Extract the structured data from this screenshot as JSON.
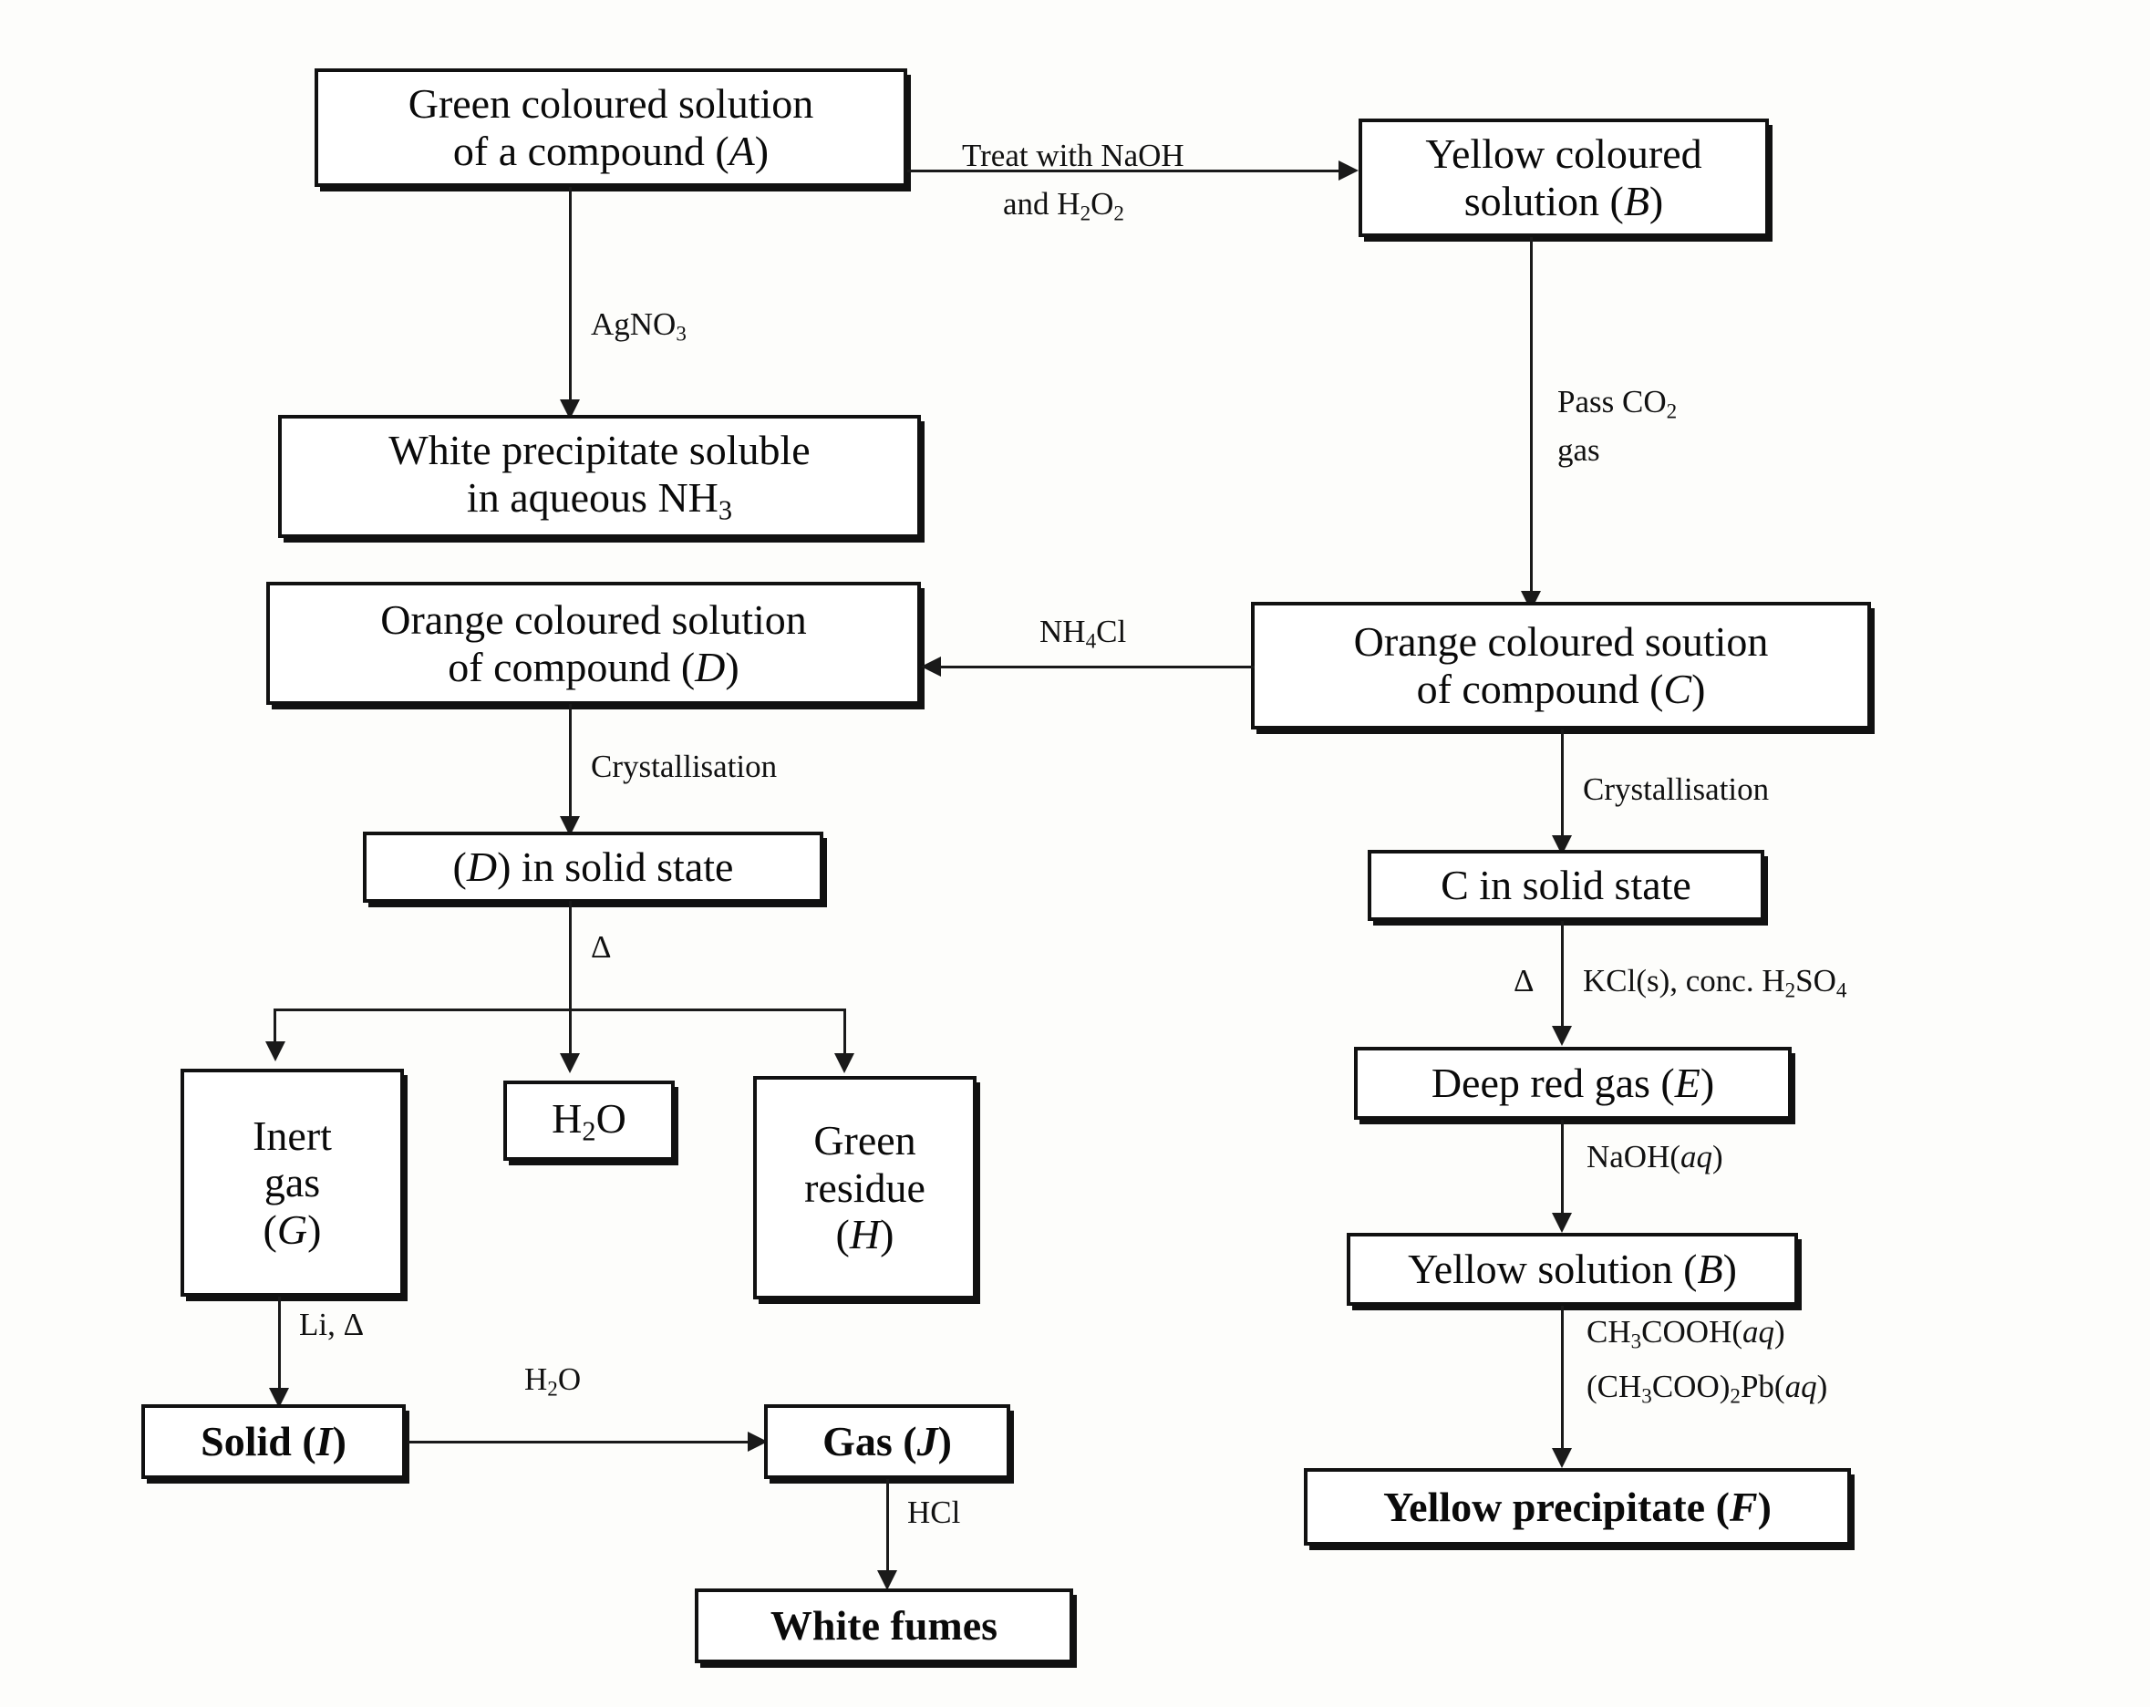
{
  "diagram": {
    "title": "Inorganic qualitative analysis flowchart (compounds A-J)",
    "nodes": {
      "a": "Green coloured solution\nof a compound (A)",
      "b": "Yellow coloured\nsolution (B)",
      "white_ppt": "White precipitate soluble\nin aqueous NH₃",
      "d_solution": "Orange coloured solution\nof compound (D)",
      "c_solution": "Orange coloured soution\nof compound (C)",
      "d_solid": "(D) in solid state",
      "c_solid": "C in solid state",
      "inert_gas": "Inert\ngas\n(G)",
      "water": "H₂O",
      "green_residue": "Green\nresidue\n(H)",
      "solid_i": "Solid (I)",
      "gas_j": "Gas (J)",
      "white_fumes": "White fumes",
      "deep_red_gas": "Deep red gas (E)",
      "yellow_solution_b": "Yellow solution (B)",
      "yellow_ppt": "Yellow precipitate (F)"
    },
    "edge_labels": {
      "a_to_b_line1": "Treat with NaOH",
      "a_to_b_line2": "and H₂O₂",
      "a_to_white_ppt": "AgNO₃",
      "b_to_c": "Pass CO₂",
      "b_to_c_line2": "gas",
      "c_to_d": "NH₄Cl",
      "d_crystallisation": "Crystallisation",
      "c_crystallisation": "Crystallisation",
      "d_heat": "Δ",
      "c_heat": "Δ",
      "c_reagent": "KCl(s), conc. H₂SO₄",
      "g_to_i": "Li, Δ",
      "i_to_j": "H₂O",
      "j_to_fumes": "HCl",
      "e_to_b": "NaOH(aq)",
      "b_to_f_line1": "CH₃COOH(aq)",
      "b_to_f_line2": "(CH₃COO)₂Pb(aq)"
    }
  },
  "chart_data": {
    "type": "diagram",
    "title": "Reaction scheme: identification of compounds A through J",
    "nodes": [
      {
        "id": "A",
        "label": "Green coloured solution of a compound (A)"
      },
      {
        "id": "B",
        "label": "Yellow coloured solution (B)"
      },
      {
        "id": "WP",
        "label": "White precipitate soluble in aqueous NH3"
      },
      {
        "id": "D",
        "label": "Orange coloured solution of compound (D)"
      },
      {
        "id": "C",
        "label": "Orange coloured soution of compound (C)"
      },
      {
        "id": "Dsolid",
        "label": "(D) in solid state"
      },
      {
        "id": "Csolid",
        "label": "C in solid state"
      },
      {
        "id": "G",
        "label": "Inert gas (G)"
      },
      {
        "id": "H2O",
        "label": "H2O"
      },
      {
        "id": "H",
        "label": "Green residue (H)"
      },
      {
        "id": "I",
        "label": "Solid (I)"
      },
      {
        "id": "J",
        "label": "Gas (J)"
      },
      {
        "id": "WF",
        "label": "White fumes"
      },
      {
        "id": "E",
        "label": "Deep red gas (E)"
      },
      {
        "id": "B2",
        "label": "Yellow solution (B)"
      },
      {
        "id": "F",
        "label": "Yellow precipitate (F)"
      }
    ],
    "edges": [
      {
        "from": "A",
        "to": "B",
        "label": "Treat with NaOH and H2O2"
      },
      {
        "from": "A",
        "to": "WP",
        "label": "AgNO3"
      },
      {
        "from": "B",
        "to": "C",
        "label": "Pass CO2 gas"
      },
      {
        "from": "C",
        "to": "D",
        "label": "NH4Cl"
      },
      {
        "from": "D",
        "to": "Dsolid",
        "label": "Crystallisation"
      },
      {
        "from": "Dsolid",
        "to": "G",
        "label": "Δ"
      },
      {
        "from": "Dsolid",
        "to": "H2O",
        "label": "Δ"
      },
      {
        "from": "Dsolid",
        "to": "H",
        "label": "Δ"
      },
      {
        "from": "G",
        "to": "I",
        "label": "Li, Δ"
      },
      {
        "from": "I",
        "to": "J",
        "label": "H2O"
      },
      {
        "from": "J",
        "to": "WF",
        "label": "HCl"
      },
      {
        "from": "C",
        "to": "Csolid",
        "label": "Crystallisation"
      },
      {
        "from": "Csolid",
        "to": "E",
        "label": "Δ KCl(s), conc. H2SO4"
      },
      {
        "from": "E",
        "to": "B2",
        "label": "NaOH(aq)"
      },
      {
        "from": "B2",
        "to": "F",
        "label": "CH3COOH(aq) (CH3COO)2Pb(aq)"
      }
    ]
  }
}
